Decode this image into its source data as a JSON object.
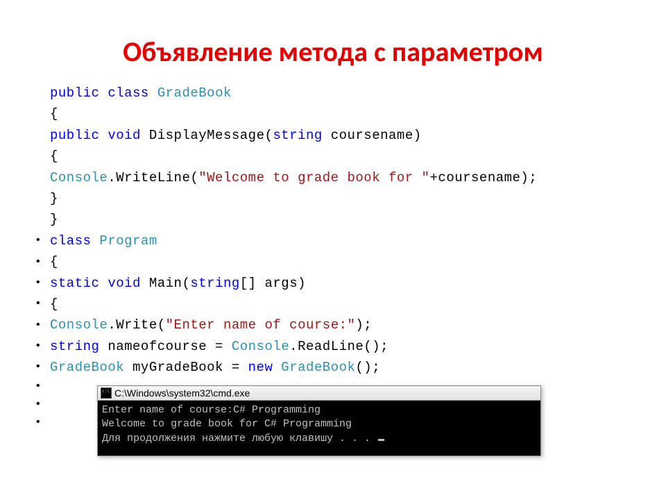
{
  "title": "Объявление метода с параметром",
  "code": {
    "line1_public": "public ",
    "line1_class": "class ",
    "line1_name": "GradeBook",
    "brace_open": "{",
    "line2_public": "public ",
    "line2_void": "void ",
    "line2_method": "DisplayMessage(",
    "line2_string": "string",
    "line2_param": " coursename)",
    "line3_console": "Console",
    "line3_dot": ".WriteLine(",
    "line3_str": "\"Welcome to grade book for \"",
    "line3_tail": "+coursename);",
    "brace_close": "}",
    "program_class": "class ",
    "program_name": "Program",
    "main_static": "static ",
    "main_void": "void ",
    "main_name": "Main(",
    "main_string": "string",
    "main_tail": "[] args)",
    "cw_console": "Console",
    "cw_dot": ".Write(",
    "cw_str": "\"Enter name of course:\"",
    "cw_tail": ");",
    "decl_string": "string",
    "decl_rest1": " nameofcourse = ",
    "decl_console": "Console",
    "decl_rest2": ".ReadLine();",
    "gb_type": "GradeBook",
    "gb_mid": " myGradeBook = ",
    "gb_new": "new ",
    "gb_type2": "GradeBook",
    "gb_tail": "();"
  },
  "console": {
    "title": "C:\\Windows\\system32\\cmd.exe",
    "line1": "Enter name of course:C# Programming",
    "line2": "Welcome to grade book for C# Programming",
    "line3": "Для продолжения нажмите любую клавишу . . . "
  }
}
